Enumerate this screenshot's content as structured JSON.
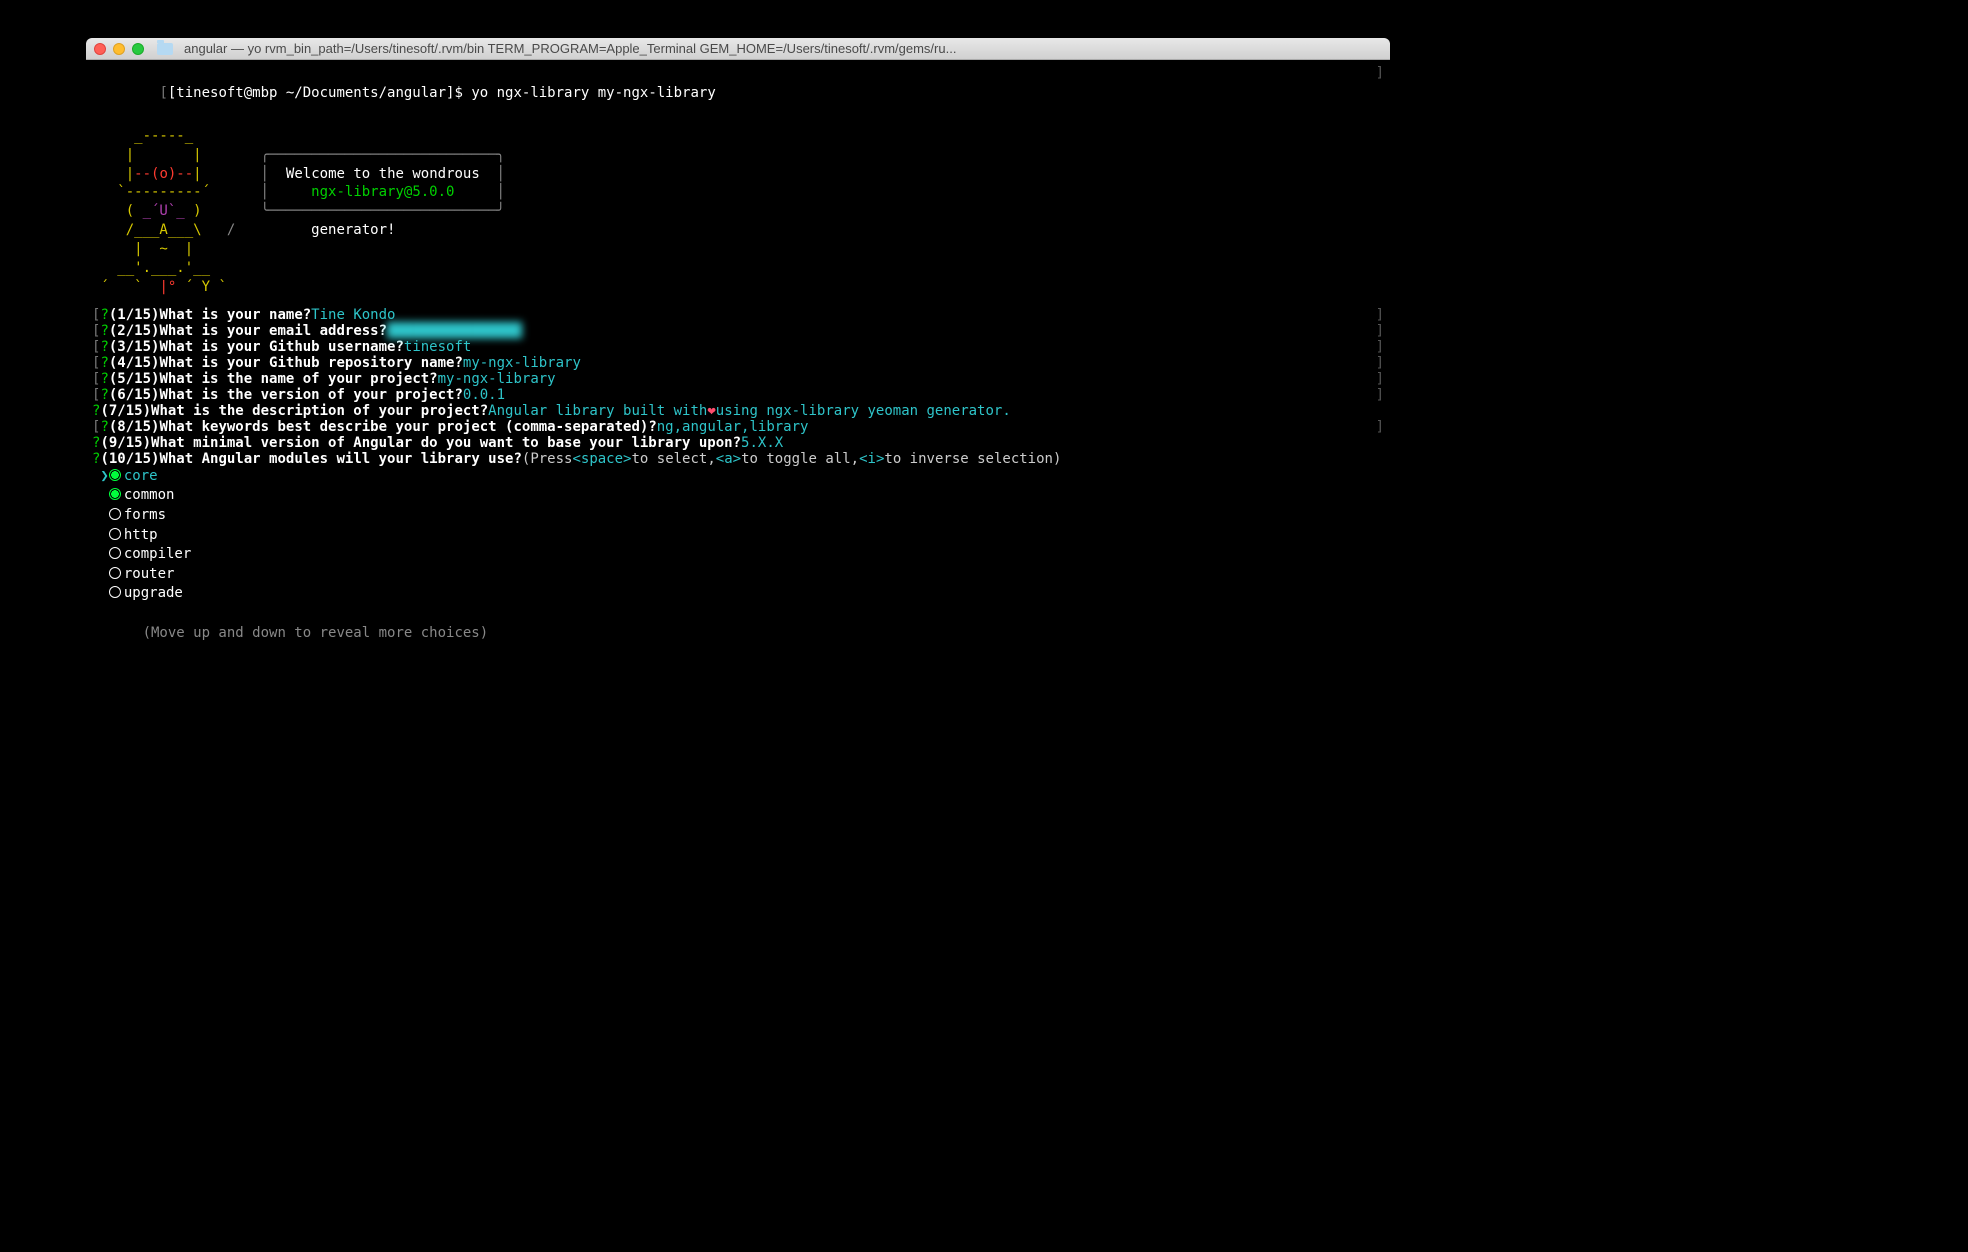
{
  "title": "angular — yo rvm_bin_path=/Users/tinesoft/.rvm/bin TERM_PROGRAM=Apple_Terminal GEM_HOME=/Users/tinesoft/.rvm/gems/ru...",
  "shell": {
    "prompt": "[tinesoft@mbp ~/Documents/angular]$ ",
    "command": "yo ngx-library my-ngx-library"
  },
  "banner": {
    "yeoman_ascii": "     _-----_\n    |       |       ╭───────────────────────────╮\n    |--(o)--|       │  Welcome to the wondrous  │\n   `---------´      │     ngx-library@5.0.0     │\n    ( _´U`_ )       │        generator!         │\n    /___A___\\   /   ╰───────────────────────────╯\n     |  ~  |\n   __'.___.'__\n ´   `  |° ´ Y `"
  },
  "questions": [
    {
      "n": "1/15",
      "q": "What is your name?",
      "a": "Tine Kondo",
      "bracketed": true
    },
    {
      "n": "2/15",
      "q": "What is your email address?",
      "a": "████████████████",
      "bracketed": true,
      "blurred": true
    },
    {
      "n": "3/15",
      "q": "What is your Github username?",
      "a": "tinesoft",
      "bracketed": true
    },
    {
      "n": "4/15",
      "q": "What is your Github repository name?",
      "a": "my-ngx-library",
      "bracketed": true
    },
    {
      "n": "5/15",
      "q": "What is the name of your project?",
      "a": "my-ngx-library",
      "bracketed": true
    },
    {
      "n": "6/15",
      "q": "What is the version of your project?",
      "a": "0.0.1",
      "bracketed": true
    },
    {
      "n": "7/15",
      "q": "What is the description of your project?",
      "a_prefix": "Angular library built with ",
      "a_suffix": " using ngx-library yeoman generator.",
      "heart": true,
      "bracketed": false
    },
    {
      "n": "8/15",
      "q": "What keywords best describe your project (comma-separated)?",
      "a": "ng,angular,library",
      "bracketed": true
    },
    {
      "n": "9/15",
      "q": "What minimal version of Angular do you want to base your library upon?",
      "a": "5.X.X",
      "bracketed": false,
      "leading_space": true
    },
    {
      "n": "10/15",
      "q": "What Angular modules will your library use?",
      "hint_seg1": " (Press ",
      "hint_key1": "<space>",
      "hint_seg2": " to select, ",
      "hint_key2": "<a>",
      "hint_seg3": " to toggle all, ",
      "hint_key3": "<i>",
      "hint_seg4": " to inverse selection)",
      "bracketed": false,
      "leading_space": true
    }
  ],
  "modules": [
    {
      "name": "core",
      "selected": true,
      "cursor": true
    },
    {
      "name": "common",
      "selected": true,
      "cursor": false
    },
    {
      "name": "forms",
      "selected": false,
      "cursor": false
    },
    {
      "name": "http",
      "selected": false,
      "cursor": false
    },
    {
      "name": "compiler",
      "selected": false,
      "cursor": false
    },
    {
      "name": "router",
      "selected": false,
      "cursor": false
    },
    {
      "name": "upgrade",
      "selected": false,
      "cursor": false
    }
  ],
  "footer_hint": "(Move up and down to reveal more choices)"
}
